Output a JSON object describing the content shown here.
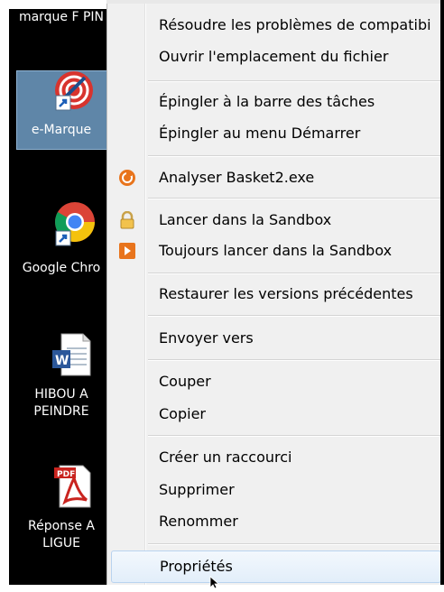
{
  "desktop": {
    "icons": [
      {
        "label": "marque F PIN",
        "icon": "shortcut-file-icon"
      },
      {
        "label": "e-Marque",
        "icon": "e-marque-app-icon"
      },
      {
        "label": "Google Chro",
        "icon": "chrome-icon"
      },
      {
        "label_line1": "HIBOU A",
        "label_line2": "PEINDRE",
        "icon": "word-document-icon"
      },
      {
        "label_line1": "Réponse A",
        "label_line2": "LIGUE",
        "icon": "pdf-document-icon"
      }
    ]
  },
  "context_menu": {
    "items": [
      {
        "label": "Résoudre les problèmes de compatibi"
      },
      {
        "label": "Ouvrir l'emplacement du fichier"
      },
      {
        "label": "Épingler à la barre des tâches"
      },
      {
        "label": "Épingler au menu Démarrer"
      },
      {
        "label": "Analyser Basket2.exe",
        "icon": "antivirus-scan-icon"
      },
      {
        "label": "Lancer dans la Sandbox",
        "icon": "sandbox-lock-icon"
      },
      {
        "label": "Toujours lancer dans la Sandbox",
        "icon": "sandbox-arrow-icon"
      },
      {
        "label": "Restaurer les versions précédentes"
      },
      {
        "label": "Envoyer vers"
      },
      {
        "label": "Couper"
      },
      {
        "label": "Copier"
      },
      {
        "label": "Créer un raccourci"
      },
      {
        "label": "Supprimer"
      },
      {
        "label": "Renommer"
      },
      {
        "label": "Propriétés"
      }
    ],
    "highlighted_item": "Propriétés"
  },
  "colors": {
    "menu_bg": "#f0f0f0",
    "highlight_border": "#b9d3ef",
    "desktop_bg": "#000000",
    "selection_bg": "#5f86a8"
  }
}
